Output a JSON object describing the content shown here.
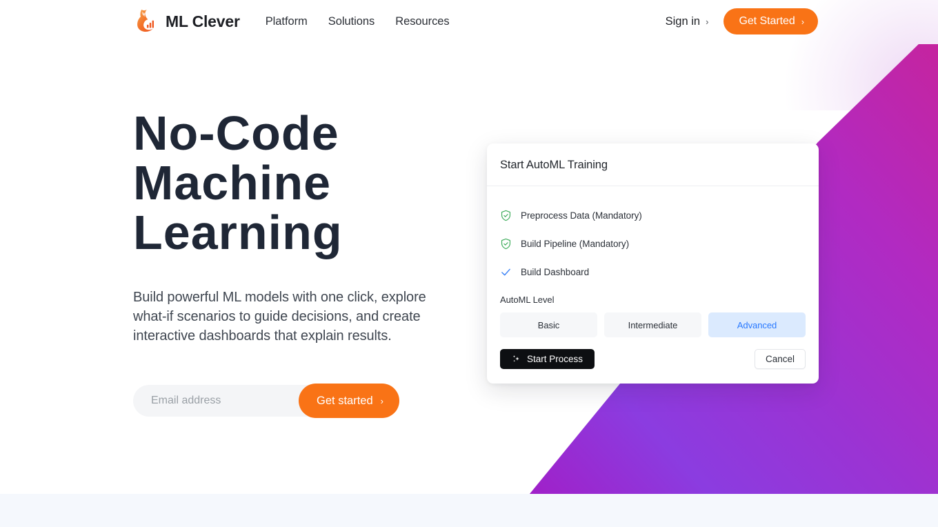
{
  "brand": {
    "name": "ML Clever",
    "logo_icon": "fox-bar-chart-logo-icon"
  },
  "header": {
    "nav": [
      {
        "label": "Platform"
      },
      {
        "label": "Solutions"
      },
      {
        "label": "Resources"
      }
    ],
    "sign_in_label": "Sign in",
    "sign_in_chevron": "›",
    "cta_label": "Get Started",
    "cta_chevron": "›"
  },
  "hero": {
    "title": "No-Code Machine Learning",
    "subtitle": "Build powerful ML models with one click, explore what-if scenarios to guide decisions, and create interactive dashboards that explain results.",
    "email_placeholder": "Email address",
    "email_value": "",
    "submit_label": "Get started",
    "submit_chevron": "›"
  },
  "automl_card": {
    "title": "Start AutoML Training",
    "tasks": [
      {
        "label": "Preprocess Data (Mandatory)",
        "icon": "shield-check-icon",
        "state": "green"
      },
      {
        "label": "Build Pipeline (Mandatory)",
        "icon": "shield-check-icon",
        "state": "green"
      },
      {
        "label": "Build Dashboard",
        "icon": "check-icon",
        "state": "blue"
      }
    ],
    "level_label": "AutoML Level",
    "levels": [
      {
        "label": "Basic",
        "selected": false
      },
      {
        "label": "Intermediate",
        "selected": false
      },
      {
        "label": "Advanced",
        "selected": true
      }
    ],
    "start_label": "Start Process",
    "start_icon": "sparkles-icon",
    "cancel_label": "Cancel"
  },
  "colors": {
    "accent_orange": "#f97316",
    "heading_navy": "#1f2736",
    "selected_blue_text": "#2979ff",
    "selected_blue_bg": "#dbeafe",
    "shield_green": "#34a853",
    "check_blue": "#3b82f6",
    "gradient_start": "#7c3aed",
    "gradient_end": "#c026a9",
    "bottom_band": "#f5f8fd"
  }
}
